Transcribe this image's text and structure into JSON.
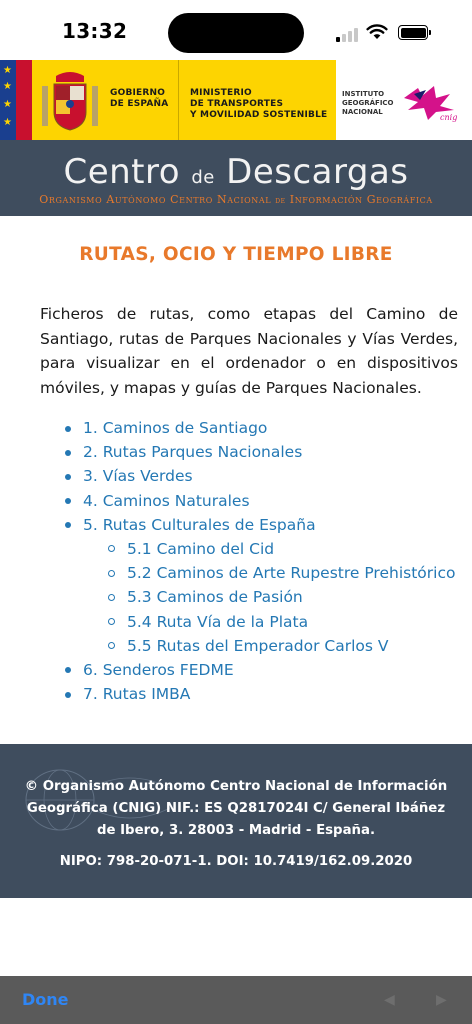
{
  "status_bar": {
    "time": "13:32"
  },
  "gov_banner": {
    "gobierno": [
      "GOBIERNO",
      "DE ESPAÑA"
    ],
    "ministerio": [
      "MINISTERIO",
      "DE TRANSPORTES",
      "Y MOVILIDAD SOSTENIBLE"
    ],
    "instituto": [
      "INSTITUTO",
      "GEOGRÁFICO",
      "NACIONAL"
    ],
    "cnig_logo_text": "cnig",
    "colors": {
      "yellow": "#fdd401",
      "red": "#c8102e",
      "eu_blue": "#1a3f8f"
    }
  },
  "header": {
    "title_part1": "Centro",
    "title_small": "de",
    "title_part2": "Descargas",
    "subtitle_part1": "Organismo Autónomo Centro Nacional",
    "subtitle_small": "de",
    "subtitle_part2": "Información Geográfica",
    "colors": {
      "background": "#3f4d5e",
      "accent": "#e8792b"
    }
  },
  "main": {
    "heading": "RUTAS, OCIO Y TIEMPO LIBRE",
    "intro": "Ficheros de rutas, como etapas del Camino de Santiago, rutas de Parques Nacionales y Vías Verdes, para visualizar en el ordenador o en dispositivos móviles, y mapas y guías de Parques Nacionales.",
    "links": [
      {
        "label": "1. Caminos de Santiago",
        "level": 1
      },
      {
        "label": "2. Rutas Parques Nacionales",
        "level": 1
      },
      {
        "label": "3. Vías Verdes",
        "level": 1
      },
      {
        "label": "4. Caminos Naturales",
        "level": 1
      },
      {
        "label": "5. Rutas Culturales de España",
        "level": 1
      },
      {
        "label": "5.1 Camino del Cid",
        "level": 2
      },
      {
        "label": "5.2 Caminos de Arte Rupestre Prehistórico",
        "level": 2
      },
      {
        "label": "5.3 Caminos de Pasión",
        "level": 2
      },
      {
        "label": "5.4 Ruta Vía de la Plata",
        "level": 2
      },
      {
        "label": "5.5 Rutas del Emperador Carlos V",
        "level": 2
      },
      {
        "label": "6. Senderos FEDME",
        "level": 1
      },
      {
        "label": "7. Rutas IMBA",
        "level": 1
      }
    ],
    "colors": {
      "link": "#2478b4",
      "heading": "#e8792b"
    }
  },
  "footer": {
    "copyright": "© Organismo Autónomo Centro Nacional de Información Geográfica (CNIG) NIF.: ES Q2817024I C/ General Ibáñez de Ibero, 3. 28003 - Madrid - España.",
    "nipo": "NIPO: 798-20-071-1. DOI: 10.7419/162.09.2020"
  },
  "toolbar": {
    "done_label": "Done",
    "back_icon": "◀",
    "forward_icon": "▶",
    "colors": {
      "done": "#2f86f5"
    }
  }
}
